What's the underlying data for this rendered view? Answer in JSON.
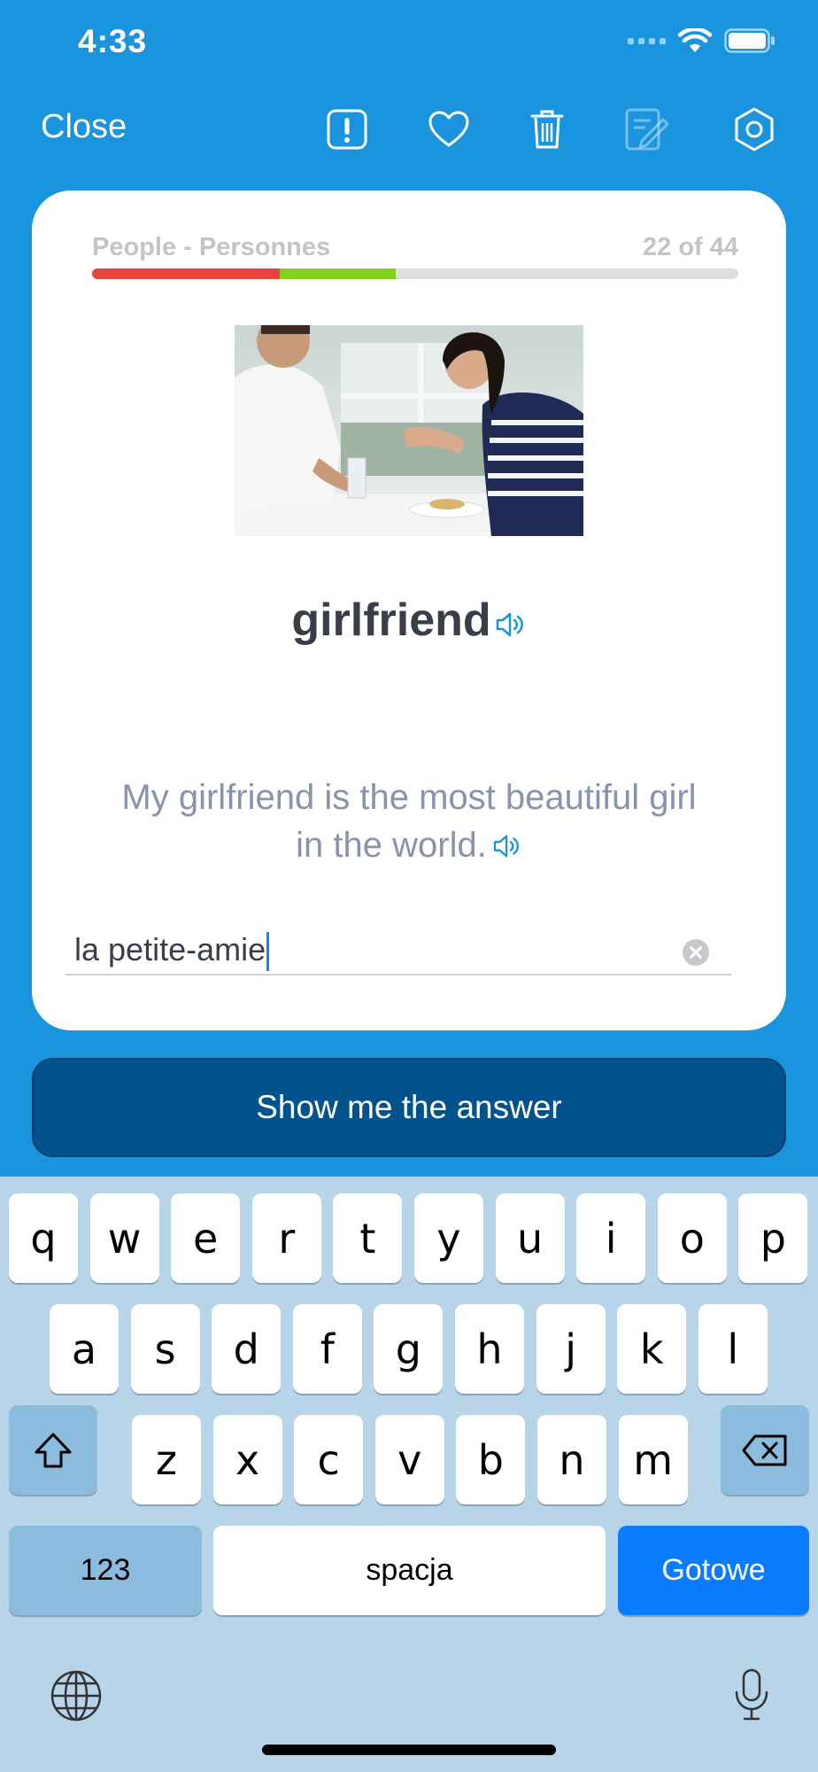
{
  "status_bar": {
    "time": "4:33"
  },
  "nav": {
    "close_label": "Close",
    "icons": [
      "report-icon",
      "heart-icon",
      "trash-icon",
      "edit-icon",
      "settings-icon"
    ]
  },
  "card": {
    "deck_name": "People - Personnes",
    "counter": "22 of 44",
    "progress": {
      "red_fraction": 0.29,
      "green_fraction": 0.18
    },
    "word": "girlfriend",
    "sentence": "My girlfriend is the most beautiful girl in the world.",
    "answer_value": "la petite-amie"
  },
  "show_answer_label": "Show me the answer",
  "keyboard": {
    "row1": [
      "q",
      "w",
      "e",
      "r",
      "t",
      "y",
      "u",
      "i",
      "o",
      "p"
    ],
    "row2": [
      "a",
      "s",
      "d",
      "f",
      "g",
      "h",
      "j",
      "k",
      "l"
    ],
    "row3": [
      "z",
      "x",
      "c",
      "v",
      "b",
      "n",
      "m"
    ],
    "numbers_label": "123",
    "space_label": "spacja",
    "done_label": "Gotowe"
  },
  "colors": {
    "background": "#1a94dd",
    "button": "#02528e",
    "progress_red": "#e9443f",
    "progress_green": "#82d11f",
    "done_key": "#0a7cff"
  }
}
